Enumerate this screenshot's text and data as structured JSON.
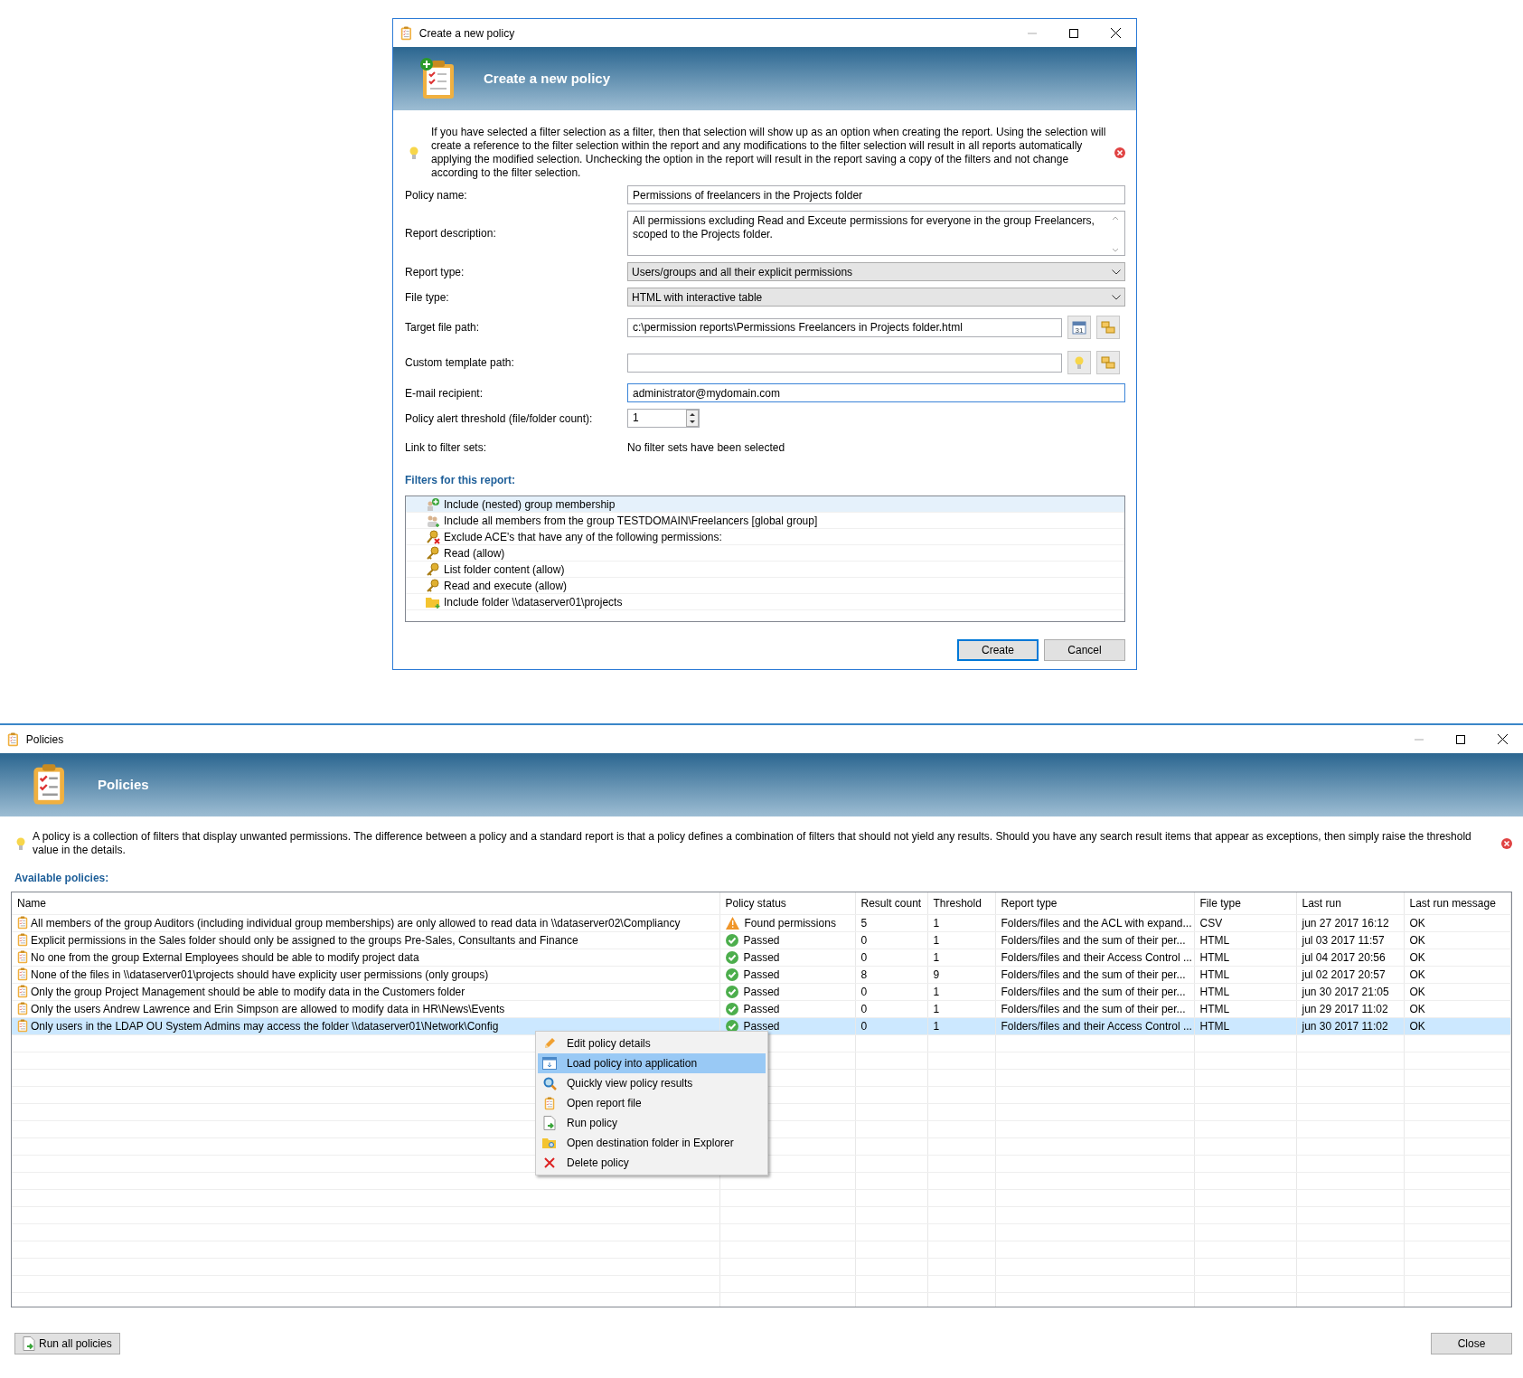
{
  "dialog": {
    "title": "Create a new policy",
    "header": "Create a new policy",
    "info": "If you have selected a filter selection as a filter, then that selection will show up as an option when creating the report. Using the selection will create a reference to the filter selection within the report and any modifications to the filter selection will result in all reports automatically applying the modified selection. Unchecking the option in the report will result in the report saving a copy of the filters and not change according to the filter selection.",
    "fields": [
      {
        "kind": "text",
        "label": "Policy name:",
        "value": "Permissions of freelancers in the Projects folder"
      },
      {
        "kind": "textarea",
        "label": "Report description:",
        "value": "All permissions excluding Read and Exceute permissions for everyone in the group Freelancers, scoped to the Projects folder."
      },
      {
        "kind": "select",
        "label": "Report type:",
        "value": "Users/groups and all their explicit permissions"
      },
      {
        "kind": "select",
        "label": "File type:",
        "value": "HTML with interactive table"
      },
      {
        "kind": "path",
        "label": "Target file path:",
        "value": "c:\\permission reports\\Permissions Freelancers in Projects folder.html",
        "tool": {
          "kind": "calendar",
          "text": "31"
        }
      },
      {
        "kind": "path",
        "label": "Custom template path:",
        "tool": {
          "kind": "bulb"
        }
      },
      {
        "kind": "text",
        "label": "E-mail recipient:",
        "value": "administrator@mydomain.com",
        "focused": true
      },
      {
        "kind": "spin",
        "label": "Policy alert threshold (file/folder count):",
        "value": "1"
      },
      {
        "kind": "static",
        "label": "Link to filter sets:",
        "value": "No filter sets have been selected"
      }
    ],
    "filters_title": "Filters for this report:",
    "filters": [
      {
        "kind": "group-add",
        "text": "Include (nested) group membership",
        "selected": true
      },
      {
        "kind": "users",
        "text": "Include all members from the group TESTDOMAIN\\Freelancers [global group]",
        "selected": false
      },
      {
        "kind": "key-deny",
        "text": "Exclude ACE's that have any of the following permissions:",
        "selected": false
      },
      {
        "kind": "key",
        "text": "Read (allow)",
        "selected": false
      },
      {
        "kind": "key",
        "text": "List folder content (allow)",
        "selected": false
      },
      {
        "kind": "key",
        "text": "Read and execute (allow)",
        "selected": false
      },
      {
        "kind": "folder",
        "text": "Include folder \\\\dataserver01\\projects",
        "selected": false
      }
    ],
    "buttons": [
      {
        "label": "Create",
        "default": true
      },
      {
        "label": "Cancel",
        "default": false
      }
    ]
  },
  "policies": {
    "title": "Policies",
    "header": "Policies",
    "info": "A policy is a collection of filters that display unwanted permissions. The difference between a policy and a standard report is that a policy defines a combination of filters that should not yield any results. Should you have any search result items that appear as exceptions, then simply raise the threshold value in the details.",
    "list_title": "Available policies:",
    "table": {
      "columns": [
        "Name",
        "Policy status",
        "Result count",
        "Threshold",
        "Report type",
        "File type",
        "Last run",
        "Last run message"
      ],
      "rows": [
        {
          "name": "All members of the group Auditors (including individual group memberships) are only allowed to read data in \\\\dataserver02\\Compliancy",
          "status": {
            "kind": "warning",
            "text": "Found permissions"
          },
          "result_count": "5",
          "threshold": "1",
          "report_type": "Folders/files and the ACL with expand...",
          "file_type": "CSV",
          "last_run": "jun 27 2017 16:12",
          "message": "OK",
          "selected": false
        },
        {
          "name": "Explicit permissions in the Sales folder should only be assigned to the groups Pre-Sales, Consultants and Finance",
          "status": {
            "kind": "passed",
            "text": "Passed"
          },
          "result_count": "0",
          "threshold": "1",
          "report_type": "Folders/files and the sum of their per...",
          "file_type": "HTML",
          "last_run": "jul 03 2017 11:57",
          "message": "OK",
          "selected": false
        },
        {
          "name": "No one from the group External Employees should be able to modify project data",
          "status": {
            "kind": "passed",
            "text": "Passed"
          },
          "result_count": "0",
          "threshold": "1",
          "report_type": "Folders/files and their Access Control ...",
          "file_type": "HTML",
          "last_run": "jul 04 2017 20:56",
          "message": "OK",
          "selected": false
        },
        {
          "name": "None of the files in \\\\dataserver01\\projects should have explicity user permissions (only groups)",
          "status": {
            "kind": "passed",
            "text": "Passed"
          },
          "result_count": "8",
          "threshold": "9",
          "report_type": "Folders/files and the sum of their per...",
          "file_type": "HTML",
          "last_run": "jul 02 2017 20:57",
          "message": "OK",
          "selected": false
        },
        {
          "name": "Only the group Project Management should be able to modify data in the Customers folder",
          "status": {
            "kind": "passed",
            "text": "Passed"
          },
          "result_count": "0",
          "threshold": "1",
          "report_type": "Folders/files and the sum of their per...",
          "file_type": "HTML",
          "last_run": "jun 30 2017 21:05",
          "message": "OK",
          "selected": false
        },
        {
          "name": "Only the users Andrew Lawrence and Erin Simpson are allowed to modify data in HR\\News\\Events",
          "status": {
            "kind": "passed",
            "text": "Passed"
          },
          "result_count": "0",
          "threshold": "1",
          "report_type": "Folders/files and the sum of their per...",
          "file_type": "HTML",
          "last_run": "jun 29 2017 11:02",
          "message": "OK",
          "selected": false
        },
        {
          "name": "Only users in the LDAP OU System Admins may access the folder \\\\dataserver01\\Network\\Config",
          "status": {
            "kind": "passed",
            "text": "Passed"
          },
          "result_count": "0",
          "threshold": "1",
          "report_type": "Folders/files and their Access Control ...",
          "file_type": "HTML",
          "last_run": "jun 30 2017 11:02",
          "message": "OK",
          "selected": true
        }
      ]
    },
    "context_menu": [
      {
        "kind": "pencil",
        "label": "Edit policy details",
        "selected": false
      },
      {
        "kind": "load",
        "label": "Load policy into application",
        "selected": true
      },
      {
        "kind": "magnifier",
        "label": "Quickly view policy results",
        "selected": false
      },
      {
        "kind": "clipboard",
        "label": "Open report file",
        "selected": false
      },
      {
        "kind": "run",
        "label": "Run policy",
        "selected": false
      },
      {
        "kind": "folder-search",
        "label": "Open destination folder in Explorer",
        "selected": false
      },
      {
        "kind": "delete",
        "label": "Delete policy",
        "selected": false
      }
    ],
    "buttons": [
      {
        "kind": "run",
        "label": "Run all policies"
      },
      {
        "kind": "plain",
        "label": "Close"
      }
    ]
  }
}
